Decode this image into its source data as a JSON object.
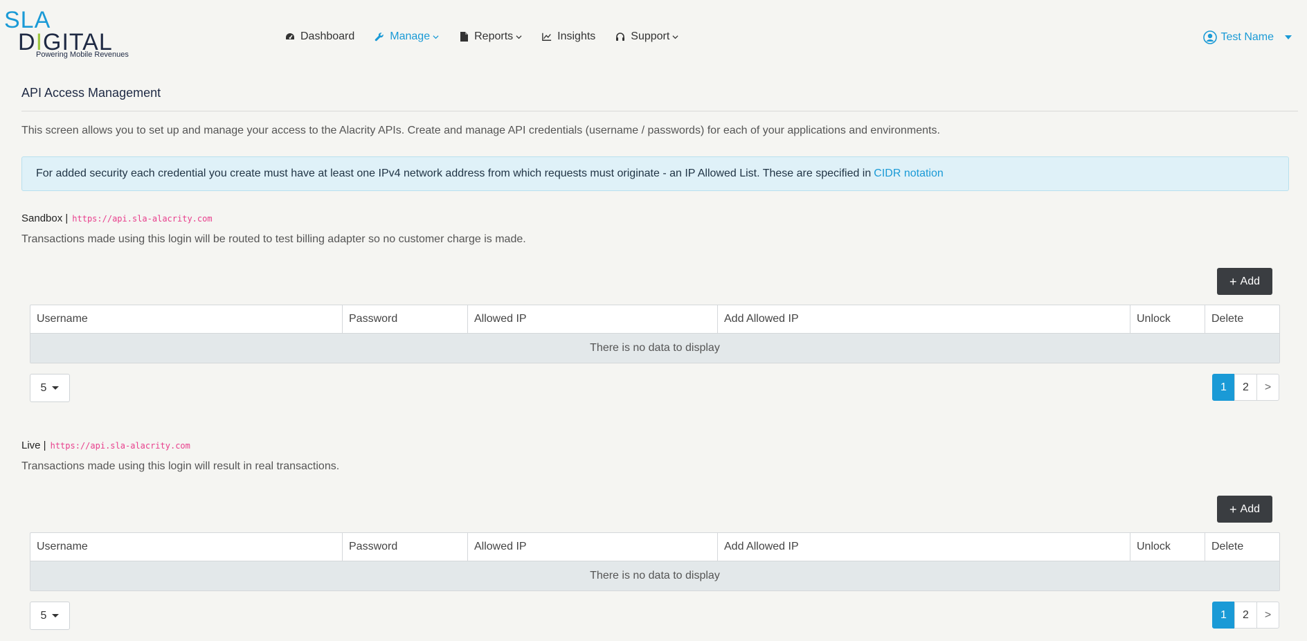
{
  "logo": {
    "line1": "SLA",
    "line2_a": "D",
    "line2_i": "I",
    "line2_b": "GITAL",
    "tagline": "Powering Mobile Revenues"
  },
  "nav": [
    {
      "label": "Dashboard",
      "icon": "dashboard-icon"
    },
    {
      "label": "Manage",
      "icon": "wrench-icon",
      "active": true
    },
    {
      "label": "Reports",
      "icon": "file-icon"
    },
    {
      "label": "Insights",
      "icon": "line-chart-icon"
    },
    {
      "label": "Support",
      "icon": "headset-icon"
    }
  ],
  "user": {
    "name": "Test Name"
  },
  "page": {
    "title": "API Access Management",
    "intro": "This screen allows you to set up and manage your access to the Alacrity APIs. Create and manage API credentials (username / passwords) for each of your applications and environments.",
    "alert_text": "For added security each credential you create must have at least one IPv4 network address from which requests must originate - an IP Allowed List. These are specified in",
    "alert_link": "CIDR notation"
  },
  "columns": [
    "Username",
    "Password",
    "Allowed IP",
    "Add Allowed IP",
    "Unlock",
    "Delete"
  ],
  "sections": [
    {
      "env": "Sandbox |",
      "url": "https://api.sla-alacrity.com",
      "desc": "Transactions made using this login will be routed to test billing adapter so no customer charge is made.",
      "add_label": "Add",
      "empty": "There is no data to display",
      "page_size": "5",
      "pages": [
        "1",
        "2",
        ">"
      ]
    },
    {
      "env": "Live |",
      "url": "https://api.sla-alacrity.com",
      "desc": "Transactions made using this login will result in real transactions.",
      "add_label": "Add",
      "empty": "There is no data to display",
      "page_size": "5",
      "pages": [
        "1",
        "2",
        ">"
      ]
    }
  ],
  "colors": {
    "accent": "#1a9ad6",
    "dark_button": "#3a3d41",
    "code": "#e83e8c"
  }
}
